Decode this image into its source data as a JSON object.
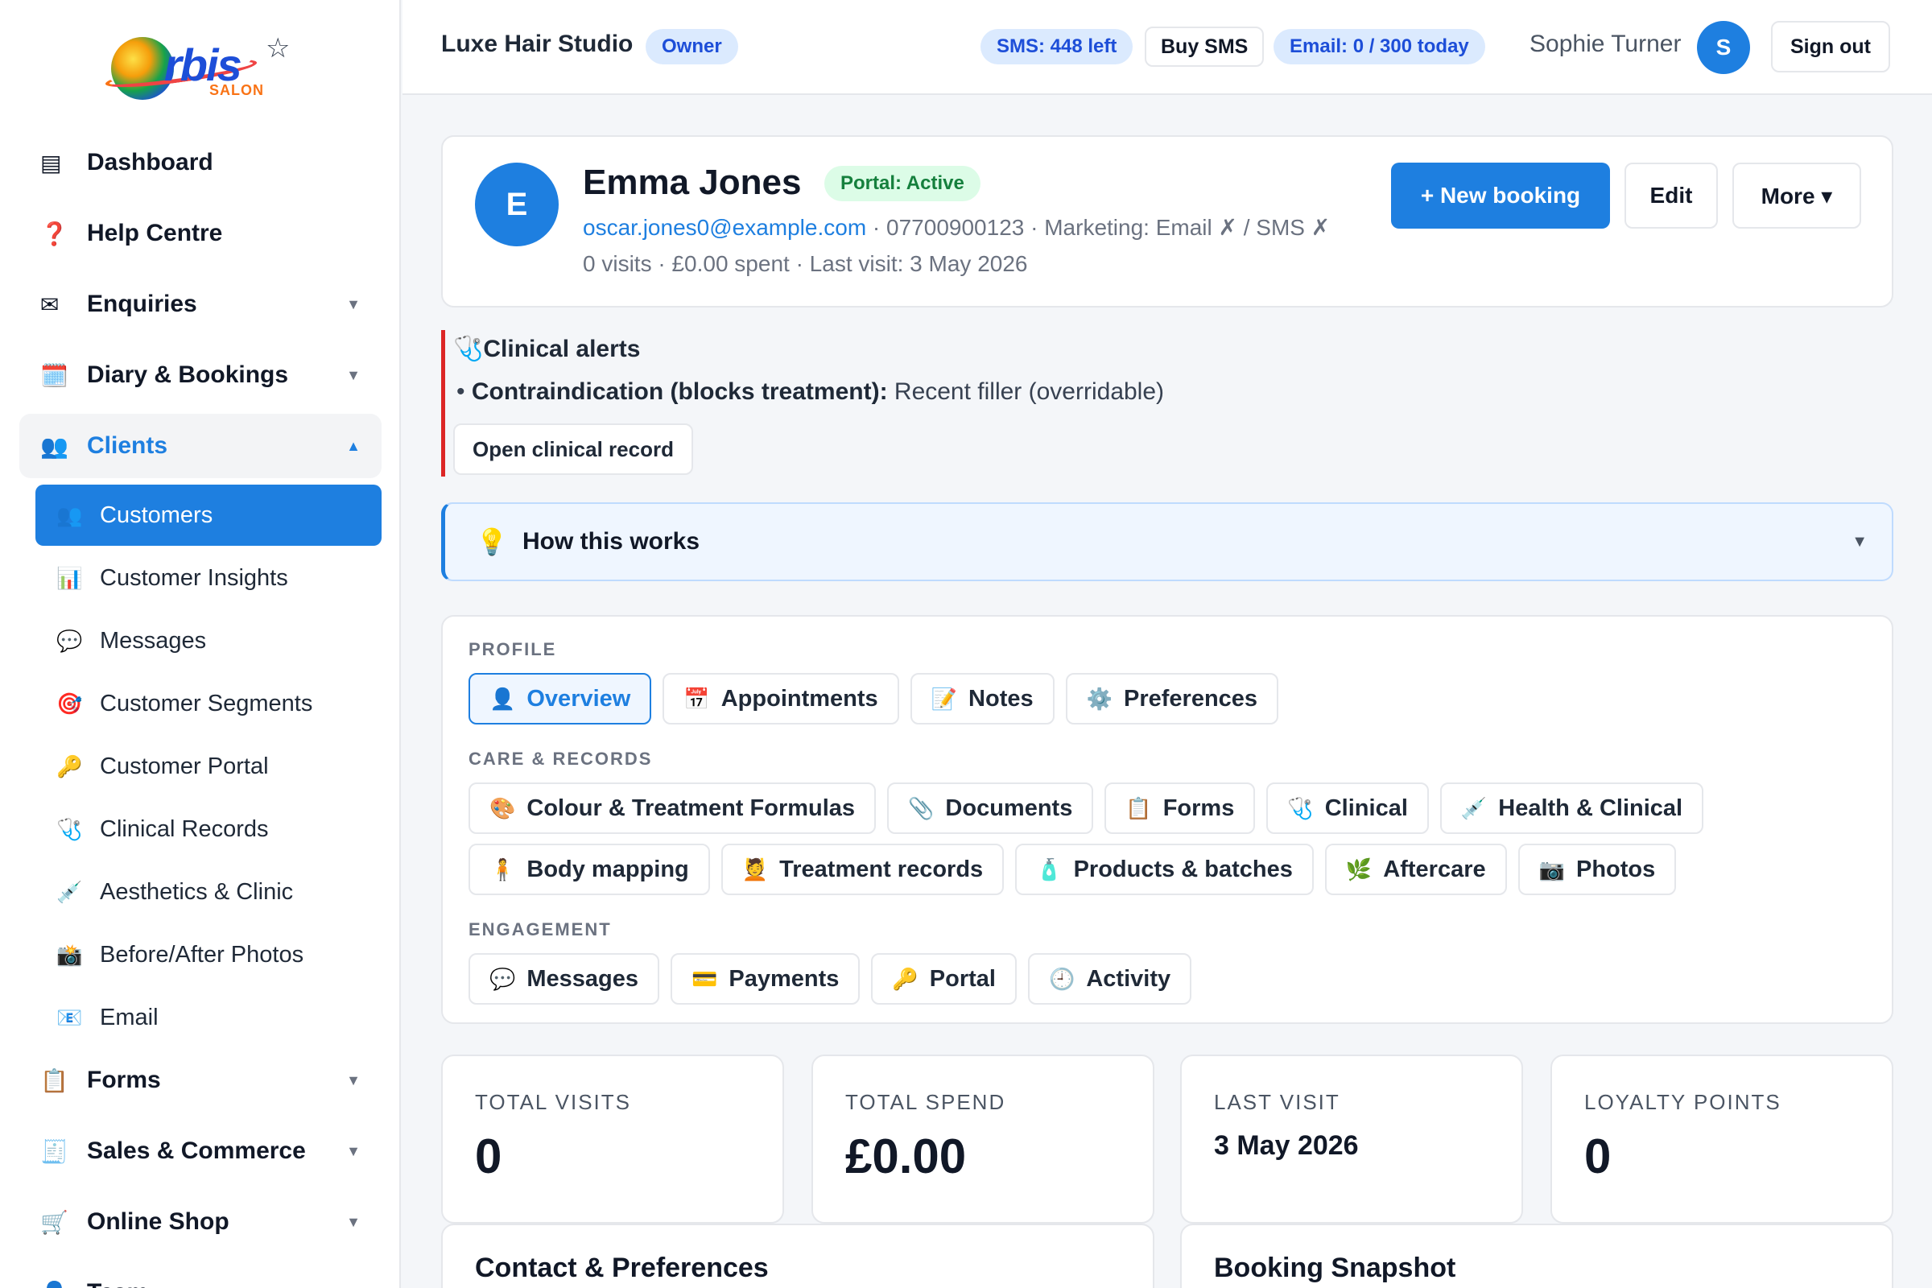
{
  "logo": {
    "word": "rbis",
    "sub": "SALON"
  },
  "sidebar": {
    "items": [
      {
        "label": "Dashboard",
        "icon": "▤"
      },
      {
        "label": "Help Centre",
        "icon": "❓"
      },
      {
        "label": "Enquiries",
        "icon": "✉"
      },
      {
        "label": "Diary & Bookings",
        "icon": "🗓️"
      }
    ],
    "clients": {
      "label": "Clients",
      "icon": "👥"
    },
    "sub_items": [
      {
        "label": "Customers",
        "icon": "👥"
      },
      {
        "label": "Customer Insights",
        "icon": "📊"
      },
      {
        "label": "Messages",
        "icon": "💬"
      },
      {
        "label": "Customer Segments",
        "icon": "🎯"
      },
      {
        "label": "Customer Portal",
        "icon": "🔑"
      },
      {
        "label": "Clinical Records",
        "icon": "🩺"
      },
      {
        "label": "Aesthetics & Clinic",
        "icon": "💉"
      },
      {
        "label": "Before/After Photos",
        "icon": "📸"
      },
      {
        "label": "Email",
        "icon": "📧"
      }
    ],
    "lower_items": [
      {
        "label": "Forms",
        "icon": "📋"
      },
      {
        "label": "Sales & Commerce",
        "icon": "🧾"
      },
      {
        "label": "Online Shop",
        "icon": "🛒"
      },
      {
        "label": "Team",
        "icon": "👤"
      }
    ]
  },
  "header": {
    "studio": "Luxe Hair Studio",
    "role": "Owner",
    "sms": "SMS: 448 left",
    "buy_sms": "Buy SMS",
    "email": "Email: 0 / 300 today",
    "user": "Sophie Turner",
    "avatar": "S",
    "sign_out": "Sign out"
  },
  "client": {
    "initial": "E",
    "name": "Emma Jones",
    "portal": "Portal: Active",
    "email": "oscar.jones0@example.com",
    "phone_marketing": " · 07700900123 · Marketing: Email ✗ / SMS ✗",
    "stats": "0 visits · £0.00 spent · Last visit: 3 May 2026",
    "new_booking": "+ New booking",
    "edit": "Edit",
    "more": "More ▾"
  },
  "alert": {
    "title": "Clinical alerts",
    "icon": "🩺",
    "label": "Contraindication (blocks treatment):",
    "text": " Recent filler (overridable)",
    "button": "Open clinical record"
  },
  "how": {
    "icon": "💡",
    "label": "How this works"
  },
  "tabs": {
    "profile_label": "PROFILE",
    "profile": [
      {
        "label": "Overview",
        "icon": "👤"
      },
      {
        "label": "Appointments",
        "icon": "📅"
      },
      {
        "label": "Notes",
        "icon": "📝"
      },
      {
        "label": "Preferences",
        "icon": "⚙️"
      }
    ],
    "care_label": "CARE & RECORDS",
    "care1": [
      {
        "label": "Colour & Treatment Formulas",
        "icon": "🎨"
      },
      {
        "label": "Documents",
        "icon": "📎"
      },
      {
        "label": "Forms",
        "icon": "📋"
      },
      {
        "label": "Clinical",
        "icon": "🩺"
      },
      {
        "label": "Health & Clinical",
        "icon": "💉"
      }
    ],
    "care2": [
      {
        "label": "Body mapping",
        "icon": "🧍"
      },
      {
        "label": "Treatment records",
        "icon": "💆"
      },
      {
        "label": "Products & batches",
        "icon": "🧴"
      },
      {
        "label": "Aftercare",
        "icon": "🌿"
      },
      {
        "label": "Photos",
        "icon": "📷"
      }
    ],
    "engagement_label": "ENGAGEMENT",
    "engagement": [
      {
        "label": "Messages",
        "icon": "💬"
      },
      {
        "label": "Payments",
        "icon": "💳"
      },
      {
        "label": "Portal",
        "icon": "🔑"
      },
      {
        "label": "Activity",
        "icon": "🕘"
      }
    ]
  },
  "stats": [
    {
      "label": "TOTAL VISITS",
      "value": "0"
    },
    {
      "label": "TOTAL SPEND",
      "value": "£0.00"
    },
    {
      "label": "LAST VISIT",
      "value": "3 May 2026"
    },
    {
      "label": "LOYALTY POINTS",
      "value": "0"
    }
  ],
  "panels": {
    "contact": "Contact & Preferences",
    "booking": "Booking Snapshot"
  },
  "colors": {
    "accent": "#1e7fe0",
    "danger": "#dc2626",
    "success": "#15803d"
  }
}
